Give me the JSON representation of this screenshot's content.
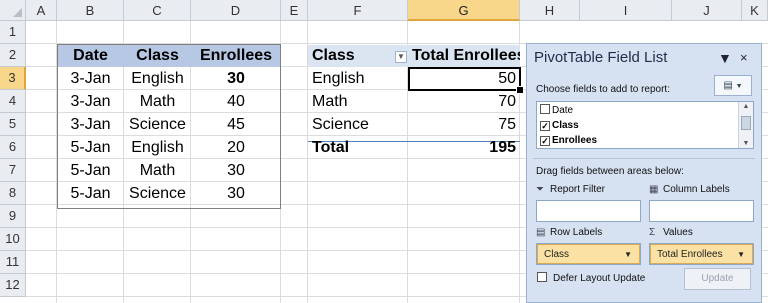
{
  "columns": [
    "A",
    "B",
    "C",
    "D",
    "E",
    "F",
    "G",
    "H",
    "I",
    "J",
    "K"
  ],
  "rows": [
    "1",
    "2",
    "3",
    "4",
    "5",
    "6",
    "7",
    "8",
    "9",
    "10",
    "11",
    "12"
  ],
  "source_table": {
    "headers": [
      "Date",
      "Class",
      "Enrollees"
    ],
    "rows": [
      [
        "3-Jan",
        "English",
        "30"
      ],
      [
        "3-Jan",
        "Math",
        "40"
      ],
      [
        "3-Jan",
        "Science",
        "45"
      ],
      [
        "5-Jan",
        "English",
        "20"
      ],
      [
        "5-Jan",
        "Math",
        "30"
      ],
      [
        "5-Jan",
        "Science",
        "30"
      ]
    ]
  },
  "pivot": {
    "header_row_label": "Class",
    "header_value": "Total Enrollees",
    "rows": [
      {
        "label": "English",
        "value": "50"
      },
      {
        "label": "Math",
        "value": "70"
      },
      {
        "label": "Science",
        "value": "75"
      }
    ],
    "total_label": "Total",
    "total_value": "195"
  },
  "field_list": {
    "title": "PivotTable Field List",
    "menu_glyph": "▼",
    "close_glyph": "×",
    "choose_text": "Choose fields to add to report:",
    "fields": [
      {
        "name": "Date",
        "checked": false
      },
      {
        "name": "Class",
        "checked": true
      },
      {
        "name": "Enrollees",
        "checked": true
      }
    ],
    "drag_text": "Drag fields between areas below:",
    "report_filter_label": "Report Filter",
    "column_labels_label": "Column Labels",
    "row_labels_label": "Row Labels",
    "values_label": "Values",
    "row_labels_item": "Class",
    "values_item": "Total Enrollees",
    "defer_label": "Defer Layout Update",
    "update_label": "Update"
  },
  "colors": {
    "header_fill": "#b7c8e4",
    "selected_header": "#f8d68a",
    "pivot_header": "#dbe5f1",
    "panel_bg": "#d6e2f2"
  }
}
